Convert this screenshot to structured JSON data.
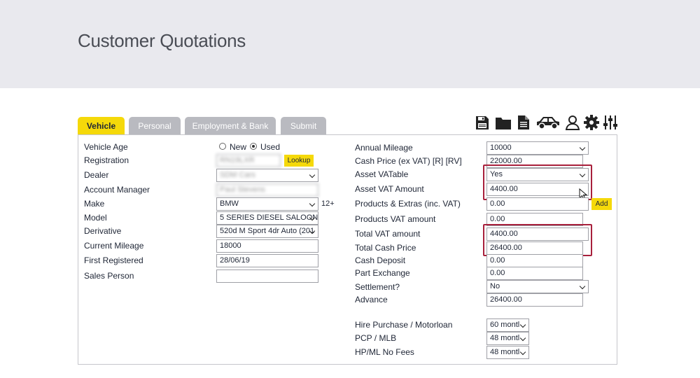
{
  "header": {
    "title": "Customer Quotations"
  },
  "tabs": [
    {
      "label": "Vehicle",
      "active": true
    },
    {
      "label": "Personal",
      "active": false
    },
    {
      "label": "Employment & Bank",
      "active": false
    },
    {
      "label": "Submit",
      "active": false
    }
  ],
  "toolbar_icons": [
    "save-icon",
    "folder-icon",
    "document-icon",
    "car-icon",
    "user-icon",
    "gear-icon",
    "sliders-icon"
  ],
  "vehicle": {
    "vehicle_age": {
      "label": "Vehicle Age",
      "options": [
        "New",
        "Used"
      ],
      "selected": "Used"
    },
    "registration": {
      "label": "Registration",
      "value": "RN19LXR",
      "button": "Lookup"
    },
    "dealer": {
      "label": "Dealer",
      "value": "SDM Cars"
    },
    "account_manager": {
      "label": "Account Manager",
      "value": "Paul Stevens"
    },
    "make": {
      "label": "Make",
      "value": "BMW",
      "age_note": "12+"
    },
    "model": {
      "label": "Model",
      "value": "5 SERIES DIESEL SALOON"
    },
    "derivative": {
      "label": "Derivative",
      "value": "520d M Sport 4dr Auto (201"
    },
    "current_mileage": {
      "label": "Current Mileage",
      "value": "18000"
    },
    "first_registered": {
      "label": "First Registered",
      "value": "28/06/19"
    },
    "sales_person": {
      "label": "Sales Person",
      "value": ""
    }
  },
  "pricing": {
    "annual_mileage": {
      "label": "Annual Mileage",
      "value": "10000"
    },
    "cash_price": {
      "label": "Cash Price (ex VAT)  [R]  [RV]",
      "value": "22000.00"
    },
    "asset_vatable": {
      "label": "Asset VATable",
      "value": "Yes"
    },
    "asset_vat_amount": {
      "label": "Asset VAT Amount",
      "value": "4400.00"
    },
    "products_extras": {
      "label": "Products & Extras (inc. VAT)",
      "value": "0.00",
      "button": "Add"
    },
    "products_vat": {
      "label": "Products VAT amount",
      "value": "0.00"
    },
    "total_vat": {
      "label": "Total VAT amount",
      "value": "4400.00"
    },
    "total_cash_price": {
      "label": "Total Cash Price",
      "value": "26400.00"
    },
    "cash_deposit": {
      "label": "Cash Deposit",
      "value": "0.00"
    },
    "part_exchange": {
      "label": "Part Exchange",
      "value": "0.00"
    },
    "settlement": {
      "label": "Settlement?",
      "value": "No"
    },
    "advance": {
      "label": "Advance",
      "value": "26400.00"
    }
  },
  "terms": {
    "hire_purchase": {
      "label": "Hire Purchase / Motorloan",
      "value": "60 montl"
    },
    "pcp": {
      "label": "PCP / MLB",
      "value": "48 montl"
    },
    "hp_no_fees": {
      "label": "HP/ML No Fees",
      "value": "48 montl"
    }
  },
  "colors": {
    "accent": "#f5d90a",
    "highlight": "#a8203c",
    "tab_inactive": "#b9bac0",
    "header_bg": "#e9e9ee"
  }
}
